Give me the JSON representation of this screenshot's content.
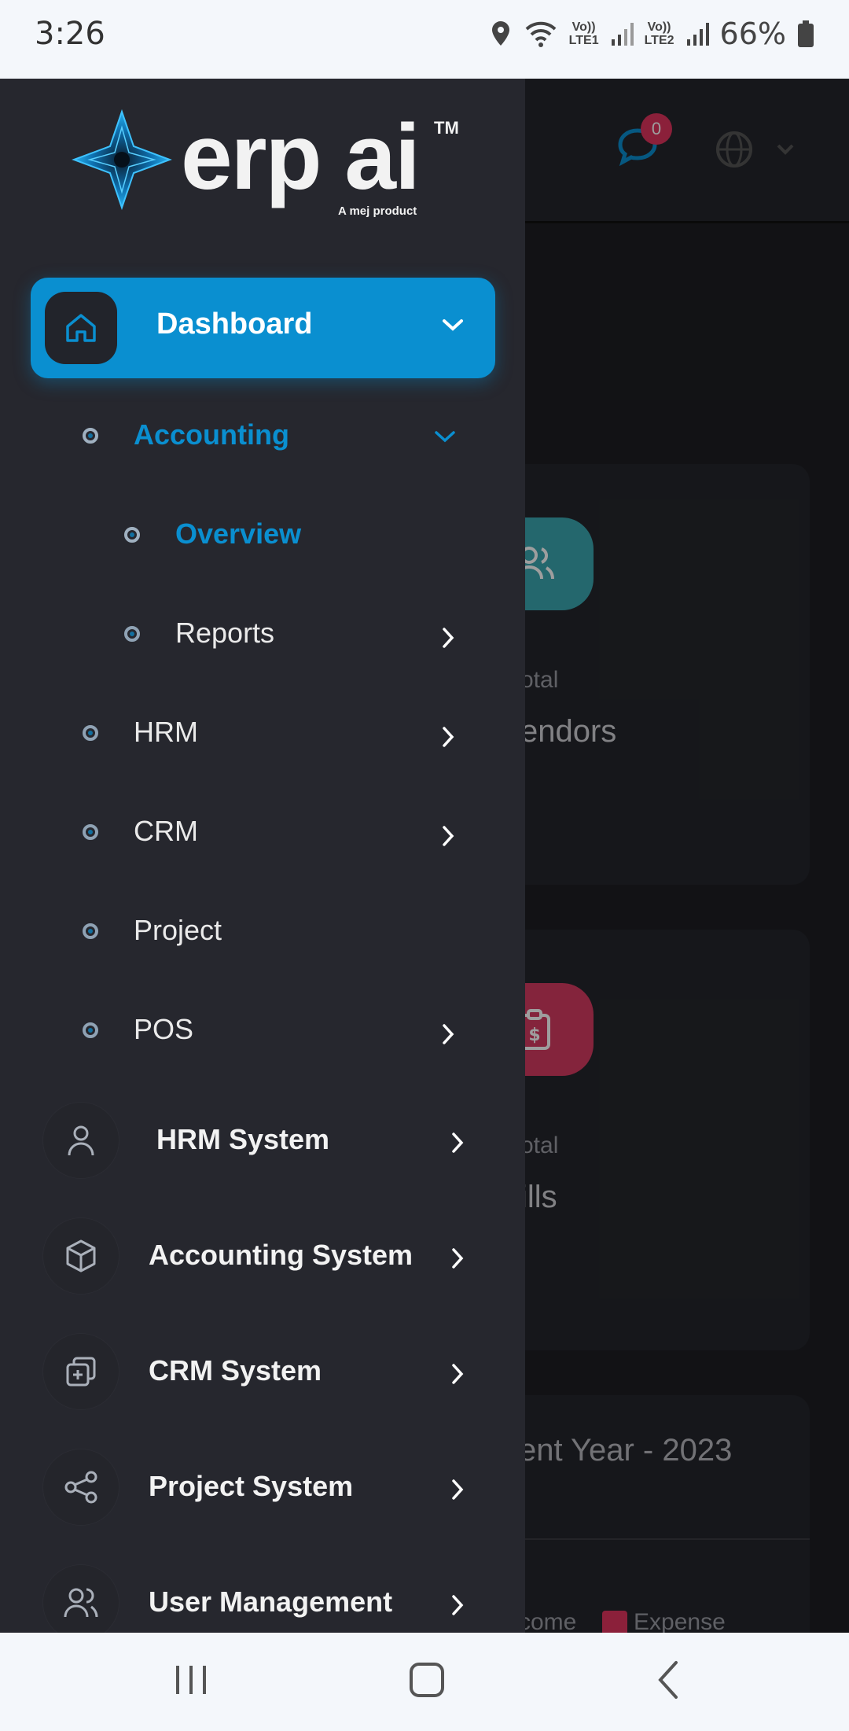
{
  "status_bar": {
    "time": "3:26",
    "lte1": [
      "Vo))",
      "LTE1"
    ],
    "lte2": [
      "Vo))",
      "LTE2"
    ],
    "battery": "66%"
  },
  "background_page": {
    "badge_count": "0",
    "card1": {
      "caption": "otal",
      "title": "endors",
      "icon_color": "#3aa7b0"
    },
    "card2": {
      "caption": "otal",
      "title": "ills",
      "icon_color": "#d63a62"
    },
    "chart_card_title": "ent Year - 2023",
    "legend": {
      "income": "come",
      "expense": "Expense",
      "expense_color": "#e0345e"
    }
  },
  "drawer": {
    "logo": {
      "text": "erp ai",
      "tm": "TM",
      "sub": "A mej product"
    },
    "dashboard": {
      "label": "Dashboard",
      "accent": "#0a8fd0"
    },
    "dashboard_children": [
      {
        "label": "Accounting",
        "active": true,
        "chevron": "down"
      },
      {
        "label": "Overview",
        "active": true,
        "chevron": "none",
        "nested": true
      },
      {
        "label": "Reports",
        "active": false,
        "chevron": "right",
        "nested": true
      },
      {
        "label": "HRM",
        "chevron": "right"
      },
      {
        "label": "CRM",
        "chevron": "right"
      },
      {
        "label": "Project",
        "chevron": "none"
      },
      {
        "label": "POS",
        "chevron": "right"
      }
    ],
    "systems": [
      {
        "label": "HRM System",
        "icon": "user-icon"
      },
      {
        "label": "Accounting System",
        "icon": "box-icon"
      },
      {
        "label": "CRM System",
        "icon": "layers-icon"
      },
      {
        "label": "Project System",
        "icon": "share-icon"
      },
      {
        "label": "User Management",
        "icon": "users-icon"
      }
    ]
  }
}
